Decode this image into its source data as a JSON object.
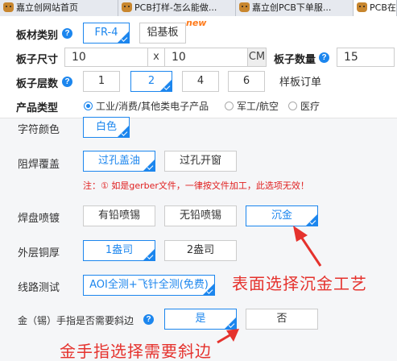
{
  "browser": {
    "tabs": [
      {
        "label": "嘉立创网站首页",
        "active": false
      },
      {
        "label": "PCB打样-怎么能做...",
        "active": false
      },
      {
        "label": "嘉立创PCB下单服...",
        "active": false
      },
      {
        "label": "PCB在线",
        "active": true
      }
    ]
  },
  "form": {
    "material": {
      "label": "板材类别",
      "options": [
        "FR-4",
        "铝基板"
      ],
      "selected": "FR-4",
      "new_badge": "new"
    },
    "size": {
      "label": "板子尺寸",
      "width": "10",
      "times": "x",
      "height": "10",
      "unit": "CM"
    },
    "quantity": {
      "label": "板子数量",
      "value": "15"
    },
    "layers": {
      "label": "板子层数",
      "options": [
        "1",
        "2",
        "4",
        "6"
      ],
      "selected": "2",
      "note": "样板订单"
    },
    "product_type": {
      "label": "产品类型",
      "options": [
        "工业/消费/其他类电子产品",
        "军工/航空",
        "医疗"
      ],
      "selected": "工业/消费/其他类电子产品"
    },
    "silkscreen": {
      "label": "字符颜色",
      "value": "白色"
    },
    "soldermask": {
      "label": "阻焊覆盖",
      "options": [
        "过孔盖油",
        "过孔开窗"
      ],
      "selected": "过孔盖油"
    },
    "note": {
      "prefix": "注：",
      "circle": "①",
      "text": "如是gerber文件，一律按文件加工，此选项无效！"
    },
    "surface": {
      "label": "焊盘喷镀",
      "options": [
        "有铅喷锡",
        "无铅喷锡",
        "沉金"
      ],
      "selected": "沉金"
    },
    "copper": {
      "label": "外层铜厚",
      "options": [
        "1盎司",
        "2盎司"
      ],
      "selected": "1盎司"
    },
    "test": {
      "label": "线路测试",
      "value": "AOI全测+飞针全测(免费)"
    },
    "bevel": {
      "label": "金（锡）手指是否需要斜边",
      "options": [
        "是",
        "否"
      ],
      "selected": "是"
    }
  },
  "annotations": {
    "surface_hint": "表面选择沉金工艺",
    "bevel_hint": "金手指选择需要斜边"
  },
  "colors": {
    "accent": "#1c86ee",
    "annotation": "#e5322d",
    "note": "#e02020"
  },
  "icons": [
    "help-icon",
    "checkmark-corner-icon",
    "arrow-icon",
    "favicon-icon"
  ]
}
